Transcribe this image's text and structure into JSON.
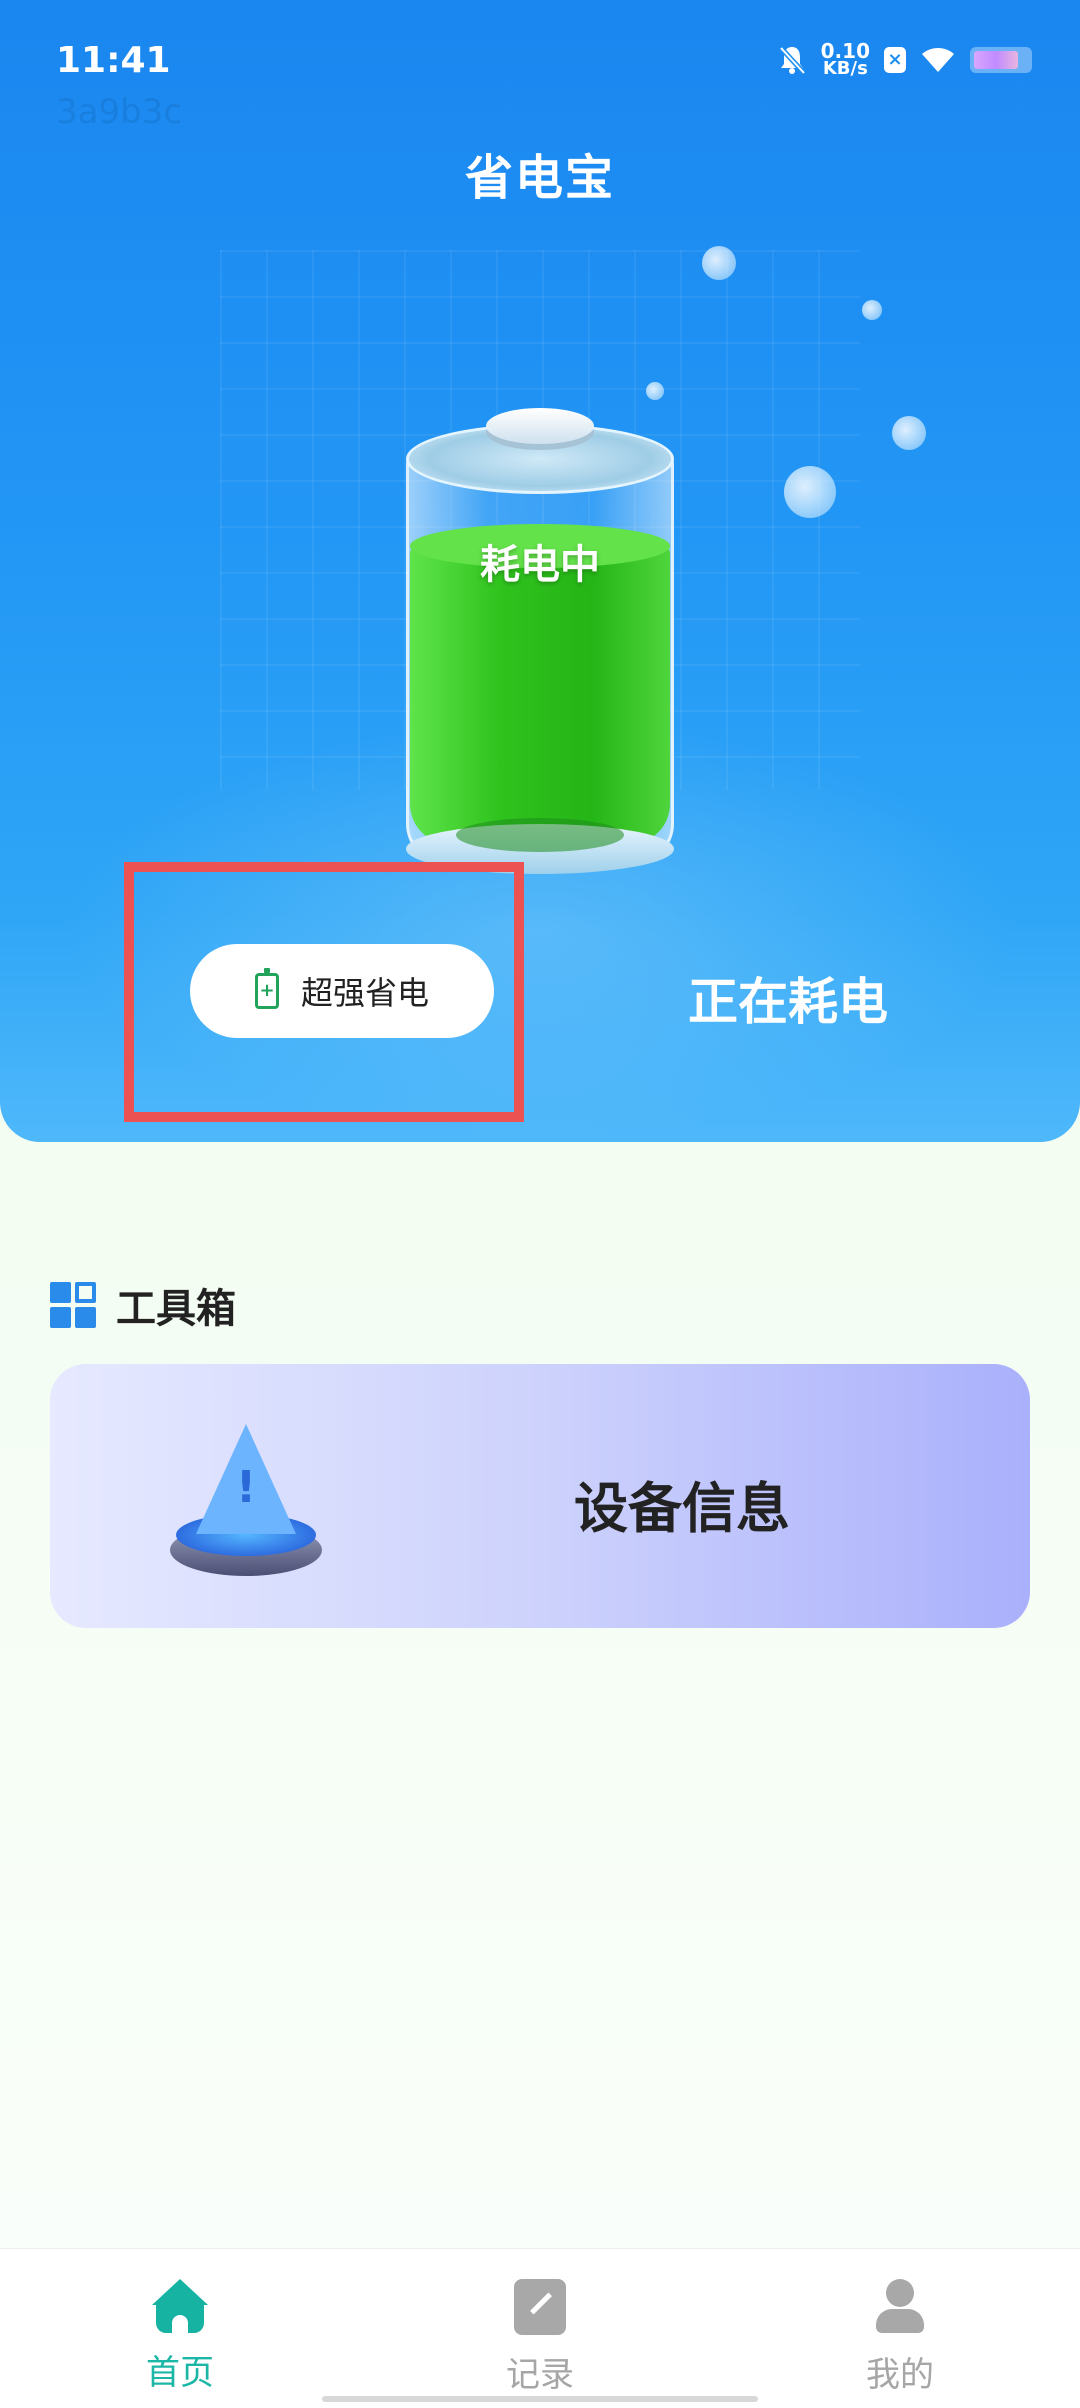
{
  "status_bar": {
    "time": "11:41",
    "watermark": "3a9b3c",
    "net_speed_value": "0.10",
    "net_speed_unit": "KB/s",
    "icons": [
      "mute-bell-icon",
      "sim-icon",
      "wifi-icon",
      "battery-icon"
    ]
  },
  "header": {
    "title": "省电宝"
  },
  "battery": {
    "status_label": "耗电中",
    "fill_level": 0.8
  },
  "mode": {
    "button_label": "超强省电",
    "status_text": "正在耗电"
  },
  "toolbox": {
    "title": "工具箱",
    "cards": [
      {
        "label": "设备信息",
        "icon": "warning-triangle-icon"
      }
    ]
  },
  "bottom_nav": {
    "items": [
      {
        "label": "首页",
        "icon": "home-icon",
        "active": true
      },
      {
        "label": "记录",
        "icon": "note-icon",
        "active": false
      },
      {
        "label": "我的",
        "icon": "user-icon",
        "active": false
      }
    ]
  },
  "colors": {
    "hero_blue": "#2296f5",
    "accent_teal": "#16b3a2",
    "battery_green": "#2fc21d",
    "highlight_red": "#ec5252"
  }
}
